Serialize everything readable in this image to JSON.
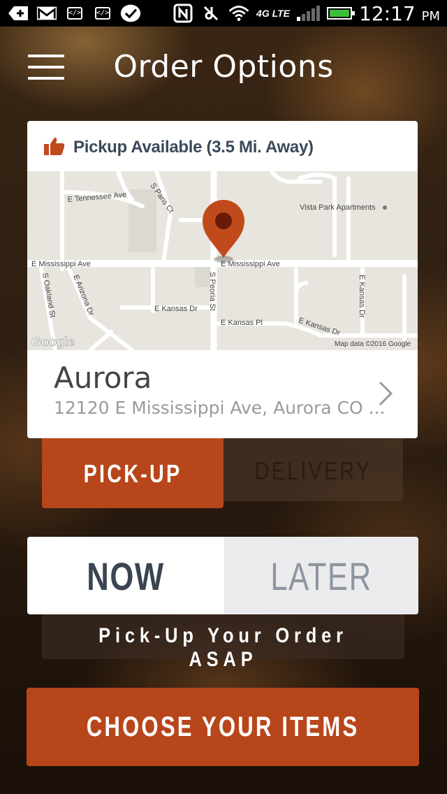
{
  "status_bar": {
    "time": "12:17",
    "ampm": "PM",
    "network": "4G LTE",
    "icons": [
      "add-icon",
      "gmail-icon",
      "code-icon",
      "code-icon",
      "check-icon",
      "nfc-icon",
      "mute-icon",
      "wifi-icon",
      "signal-icon",
      "battery-icon"
    ]
  },
  "header": {
    "title": "Order Options",
    "menu_icon": "hamburger-icon"
  },
  "store_card": {
    "availability": "Pickup Available (3.5 Mi. Away)",
    "availability_icon": "thumbs-up-icon",
    "location_name": "Aurora",
    "address": "12120 E Mississippi Ave, Aurora CO ...",
    "chevron_icon": "chevron-right-icon"
  },
  "map": {
    "labels": {
      "tennessee": "E Tennessee Ave",
      "paris": "S Paris Ct",
      "vista": "Vista Park Apartments",
      "mississippi_w": "E Mississippi Ave",
      "mississippi_e": "E Mississippi Ave",
      "oakland": "S Oakland St",
      "arizona": "E Arizona Dr",
      "kansas_dr_w": "E Kansas Dr",
      "peoria": "S Peoria St",
      "kansas_pl": "E Kansas Pl",
      "kansas_dr_e": "E Kansas Dr",
      "kansas_dr_v": "E Kansas Dr",
      "google": "Google",
      "attribution": "Map data ©2016 Google"
    },
    "pin_color": "#c14a1c"
  },
  "fulfillment": {
    "options": [
      "PICK-UP",
      "DELIVERY"
    ],
    "selected": "PICK-UP"
  },
  "timing": {
    "options": [
      "NOW",
      "LATER"
    ],
    "selected": "NOW",
    "message": "Pick-Up Your Order ASAP"
  },
  "cta": {
    "label": "CHOOSE YOUR ITEMS"
  },
  "colors": {
    "accent": "#b8461b",
    "text_dark": "#3a4552",
    "text_muted": "#8d96a0"
  }
}
